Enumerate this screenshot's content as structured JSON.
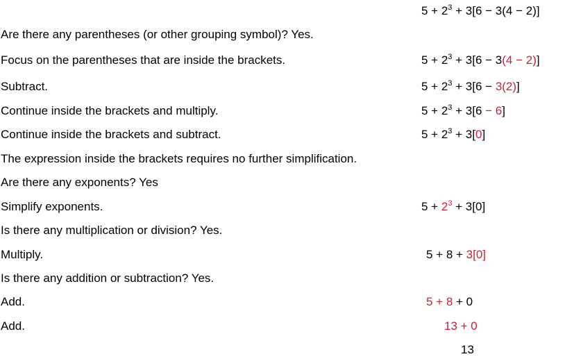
{
  "colors": {
    "text": "#000000",
    "highlight": "#cf1d35",
    "background": "#ffffff"
  },
  "steps": [
    {
      "description": "",
      "expression": [
        {
          "text": "5 + 2",
          "hl": false
        },
        {
          "sup": "3",
          "hl": false
        },
        {
          "text": " + 3[6 − 3(4 − 2)]",
          "hl": false
        }
      ]
    },
    {
      "description": "Are there any parentheses (or other grouping symbol)? Yes.",
      "expression": []
    },
    {
      "description": "Focus on the parentheses that are inside the brackets.",
      "expression": [
        {
          "text": "5 + 2",
          "hl": false
        },
        {
          "sup": "3",
          "hl": false
        },
        {
          "text": " + 3[6 − 3",
          "hl": false
        },
        {
          "text": "(4 − 2)",
          "hl": true
        },
        {
          "text": "]",
          "hl": false
        }
      ]
    },
    {
      "description": "Subtract.",
      "expression": [
        {
          "text": "5 + 2",
          "hl": false
        },
        {
          "sup": "3",
          "hl": false
        },
        {
          "text": " + 3[6 − ",
          "hl": false
        },
        {
          "text": "3(2)",
          "hl": true
        },
        {
          "text": "]",
          "hl": false
        }
      ]
    },
    {
      "description": "Continue inside the brackets and multiply.",
      "expression": [
        {
          "text": "5 + 2",
          "hl": false
        },
        {
          "sup": "3",
          "hl": false
        },
        {
          "text": " + 3[6 ",
          "hl": false
        },
        {
          "text": "− 6",
          "hl": true
        },
        {
          "text": "]",
          "hl": false
        }
      ]
    },
    {
      "description": "Continue inside the brackets and subtract.",
      "expression": [
        {
          "text": "5 + 2",
          "hl": false
        },
        {
          "sup": "3",
          "hl": false
        },
        {
          "text": " + 3[",
          "hl": false
        },
        {
          "text": "0",
          "hl": true
        },
        {
          "text": "]",
          "hl": false
        }
      ]
    },
    {
      "description": "The expression inside the brackets requires no further simplification.",
      "expression": []
    },
    {
      "description": "Are there any exponents? Yes",
      "expression": []
    },
    {
      "description": "Simplify exponents.",
      "expression": [
        {
          "text": "5 + ",
          "hl": false
        },
        {
          "text": "2",
          "hl": true
        },
        {
          "sup": "3",
          "hl": true
        },
        {
          "text": " + 3[0]",
          "hl": false
        }
      ]
    },
    {
      "description": "Is there any multiplication or division? Yes.",
      "expression": []
    },
    {
      "description": "Multiply.",
      "expression": [
        {
          "text": "5 + 8 + ",
          "hl": false
        },
        {
          "text": "3[0]",
          "hl": true
        }
      ]
    },
    {
      "description": "Is there any addition or subtraction? Yes.",
      "expression": []
    },
    {
      "description": "Add.",
      "expression": [
        {
          "text": "5 + 8",
          "hl": true
        },
        {
          "text": " + 0",
          "hl": false
        }
      ]
    },
    {
      "description": "Add.",
      "expression": [
        {
          "text": "13 + 0",
          "hl": true
        }
      ]
    },
    {
      "description": "",
      "expression": [
        {
          "text": "13",
          "hl": false
        }
      ]
    }
  ]
}
